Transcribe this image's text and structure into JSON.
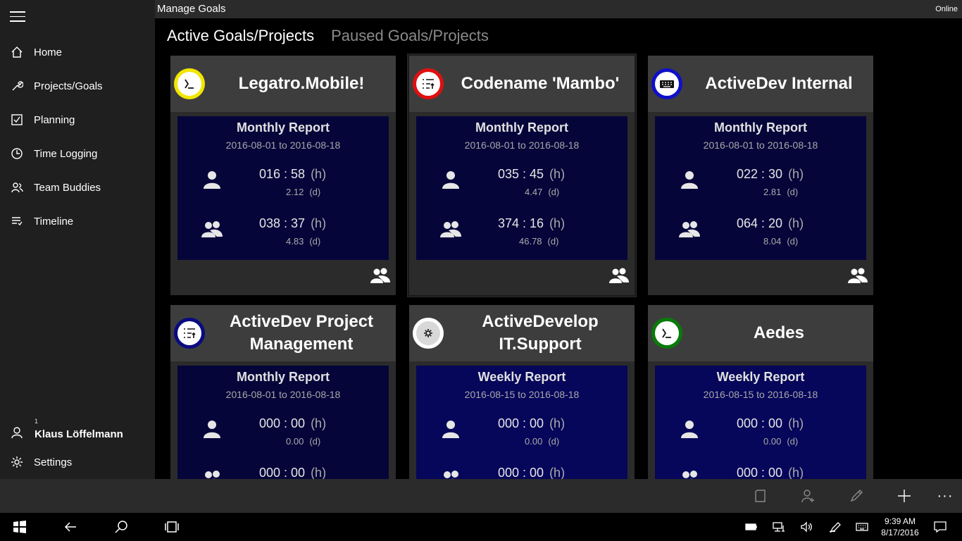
{
  "app": {
    "title": "Manage Goals",
    "status": "Online"
  },
  "sidebar": {
    "items": [
      {
        "label": "Home",
        "icon": "home-icon"
      },
      {
        "label": "Projects/Goals",
        "icon": "wrench-icon"
      },
      {
        "label": "Planning",
        "icon": "checkbox-icon"
      },
      {
        "label": "Time Logging",
        "icon": "clock-icon"
      },
      {
        "label": "Team Buddies",
        "icon": "team-icon"
      },
      {
        "label": "Timeline",
        "icon": "timeline-icon"
      }
    ],
    "user": {
      "badge": "1",
      "name": "Klaus Löffelmann"
    },
    "settings": {
      "label": "Settings"
    }
  },
  "pivot": {
    "active": "Active Goals/Projects",
    "inactive": "Paused Goals/Projects"
  },
  "cards": [
    {
      "title": "Legatro.Mobile!",
      "icon": "terminal-icon",
      "ring": "#f2e600",
      "fill": "#ffffff",
      "report": "Monthly Report",
      "range": "2016-08-01 to 2016-08-18",
      "my_h": "016 : 58",
      "my_d": "2.12",
      "team_h": "038 : 37",
      "team_d": "4.83"
    },
    {
      "title": "Codename 'Mambo'",
      "icon": "tasklist-icon",
      "ring": "#e01010",
      "fill": "#ffffff",
      "report": "Monthly Report",
      "range": "2016-08-01 to 2016-08-18",
      "my_h": "035 : 45",
      "my_d": "4.47",
      "team_h": "374 : 16",
      "team_d": "46.78"
    },
    {
      "title": "ActiveDev Internal",
      "icon": "keyboard-icon",
      "ring": "#1010c8",
      "fill": "#ffffff",
      "report": "Monthly Report",
      "range": "2016-08-01 to 2016-08-18",
      "my_h": "022 : 30",
      "my_d": "2.81",
      "team_h": "064 : 20",
      "team_d": "8.04"
    },
    {
      "title": "ActiveDev Project Management",
      "icon": "tasklist-icon",
      "ring": "#0a0a80",
      "fill": "#ffffff",
      "report": "Monthly Report",
      "range": "2016-08-01 to 2016-08-18",
      "my_h": "000 : 00",
      "my_d": "0.00",
      "team_h": "000 : 00",
      "team_d": ""
    },
    {
      "title": "ActiveDevelop IT.Support",
      "icon": "gear-icon",
      "ring": "#ffffff",
      "fill": "#ffffff",
      "report": "Weekly Report",
      "range": "2016-08-15 to 2016-08-18",
      "my_h": "000 : 00",
      "my_d": "0.00",
      "team_h": "000 : 00",
      "team_d": ""
    },
    {
      "title": "Aedes",
      "icon": "terminal-icon",
      "ring": "#0a7a0a",
      "fill": "#ffffff",
      "report": "Weekly Report",
      "range": "2016-08-15 to 2016-08-18",
      "my_h": "000 : 00",
      "my_d": "0.00",
      "team_h": "000 : 00",
      "team_d": ""
    }
  ],
  "units": {
    "hours": "(h)",
    "days": "(d)"
  },
  "commandbar": [
    "page-icon",
    "add-person-icon",
    "edit-icon",
    "add-icon",
    "more-icon"
  ],
  "taskbar": {
    "time": "9:39 AM",
    "date": "8/17/2016"
  }
}
